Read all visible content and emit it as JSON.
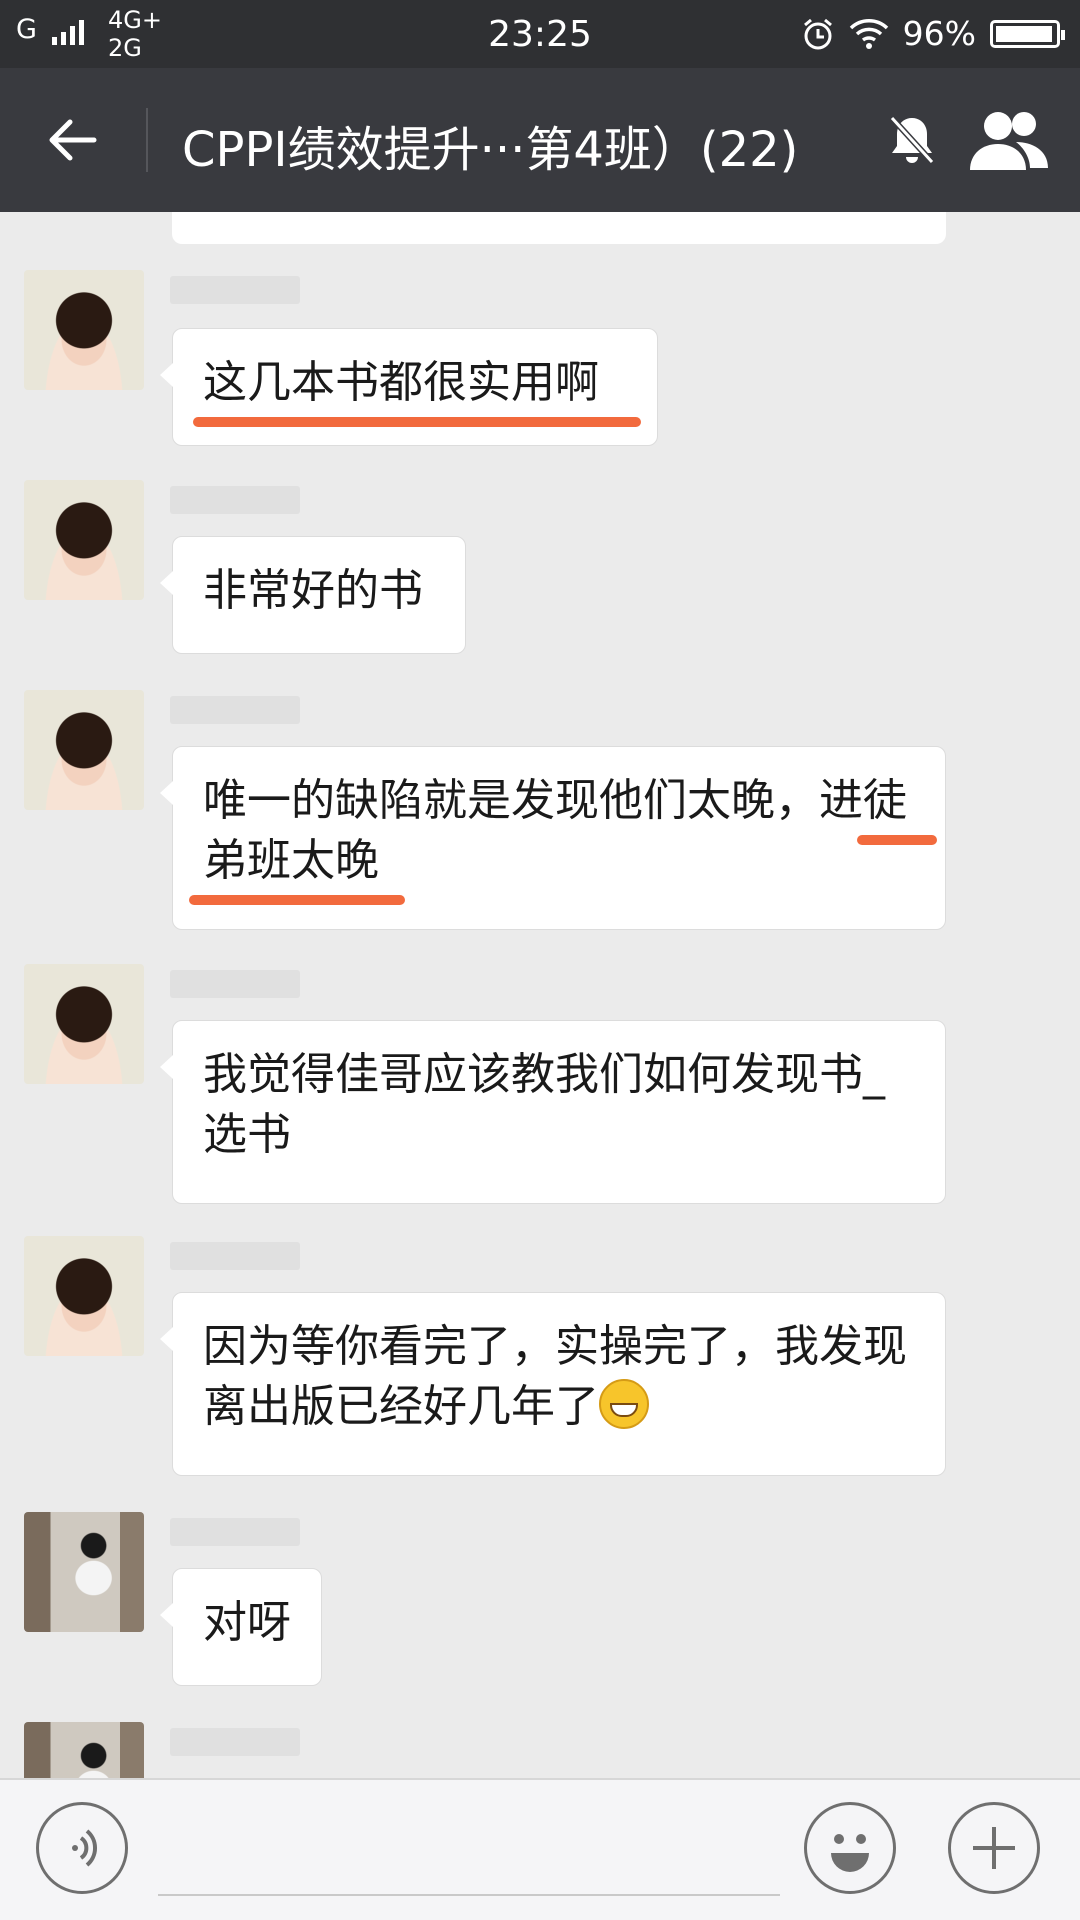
{
  "status_bar": {
    "carrier_label": "G",
    "network_label_1": "4G+",
    "network_label_2": "2G",
    "time": "23:25",
    "battery_percent": "96%",
    "icons": [
      "signal-icon",
      "alarm-icon",
      "wifi-icon",
      "battery-icon"
    ]
  },
  "header": {
    "title": "CPPI绩效提升···第4班）(22)",
    "icons": [
      "back-arrow-icon",
      "mute-bell-icon",
      "group-members-icon"
    ]
  },
  "messages": [
    {
      "text": "这几本书都很实用啊"
    },
    {
      "text": "非常好的书"
    },
    {
      "text": "唯一的缺陷就是发现他们太晚，进徒弟班太晚"
    },
    {
      "text": "我觉得佳哥应该教我们如何发现书_选书"
    },
    {
      "text": "因为等你看完了，实操完了，我发现离出版已经好几年了",
      "emoji": "grinning-face-icon"
    },
    {
      "text": "对呀"
    }
  ],
  "input_bar": {
    "icons": [
      "voice-icon",
      "emoji-icon",
      "plus-icon"
    ]
  },
  "colors": {
    "titlebar_bg": "#393a3f",
    "statusbar_bg": "#2f3033",
    "chat_bg": "#ebebeb",
    "annotation_underline": "#f26a3d"
  }
}
